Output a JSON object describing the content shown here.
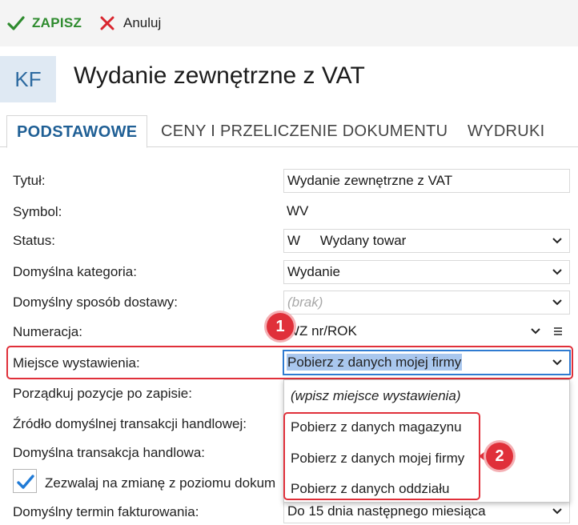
{
  "toolbar": {
    "save_label": "ZAPISZ",
    "cancel_label": "Anuluj"
  },
  "header": {
    "badge": "KF",
    "title": "Wydanie zewnętrzne z VAT"
  },
  "tabs": [
    {
      "label": "PODSTAWOWE",
      "active": true
    },
    {
      "label": "CENY I PRZELICZENIE DOKUMENTU",
      "active": false
    },
    {
      "label": "WYDRUKI",
      "active": false
    }
  ],
  "form": {
    "title": {
      "label": "Tytuł:",
      "value": "Wydanie zewnętrzne z VAT"
    },
    "symbol": {
      "label": "Symbol:",
      "value": "WV"
    },
    "status": {
      "label": "Status:",
      "code": "W",
      "value": "Wydany towar"
    },
    "category": {
      "label": "Domyślna kategoria:",
      "value": "Wydanie"
    },
    "delivery": {
      "label": "Domyślny sposób dostawy:",
      "placeholder": "(brak)"
    },
    "numbering": {
      "label": "Numeracja:",
      "value": "WZ nr/ROK"
    },
    "place": {
      "label": "Miejsce wystawienia:",
      "value": "Pobierz z danych mojej firmy"
    },
    "sort": {
      "label": "Porządkuj pozycje po zapisie:"
    },
    "transaction_source": {
      "label": "Źródło domyślnej transakcji handlowej:"
    },
    "transaction": {
      "label": "Domyślna transakcja handlowa:"
    },
    "allow_change": {
      "label": "Zezwalaj na zmianę z poziomu dokum",
      "checked": true
    },
    "invoice_term": {
      "label": "Domyślny termin fakturowania:",
      "value": "Do 15 dnia następnego miesiąca"
    }
  },
  "dropdown": {
    "placeholder": "(wpisz miejsce wystawienia)",
    "options": [
      "Pobierz z danych magazynu",
      "Pobierz z danych mojej firmy",
      "Pobierz z danych oddziału"
    ]
  },
  "markers": [
    "1",
    "2"
  ],
  "colors": {
    "accent": "#1f5f95",
    "save": "#2e8b2e",
    "cancel": "#d9262f",
    "marker": "#e0303a",
    "selection": "#a9c7ee"
  }
}
